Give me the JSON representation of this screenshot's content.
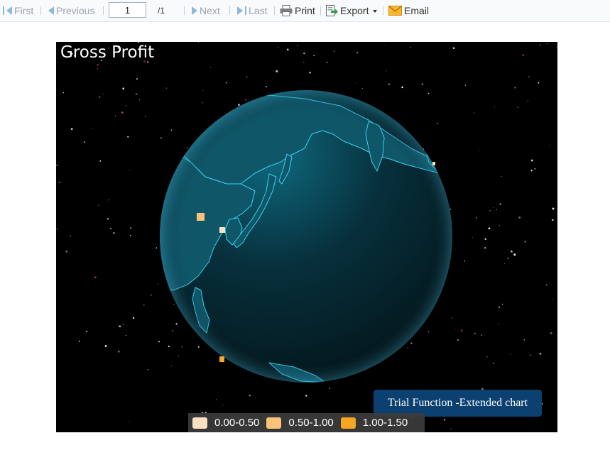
{
  "toolbar": {
    "first_label": "First",
    "previous_label": "Previous",
    "page_value": "1",
    "page_total": "/1",
    "next_label": "Next",
    "last_label": "Last",
    "print_label": "Print",
    "export_label": "Export",
    "email_label": "Email"
  },
  "chart": {
    "title": "Gross Profit",
    "watermark": "Trial Function -Extended chart",
    "legend": [
      {
        "label": "0.00-0.50",
        "color": "#fde0c0"
      },
      {
        "label": "0.50-1.00",
        "color": "#fcc27a"
      },
      {
        "label": "1.00-1.50",
        "color": "#f5a623"
      }
    ]
  },
  "colors": {
    "background": "#000000",
    "globe": "#062a36",
    "coastline": "#39d2f0",
    "land": "#0f5669"
  }
}
